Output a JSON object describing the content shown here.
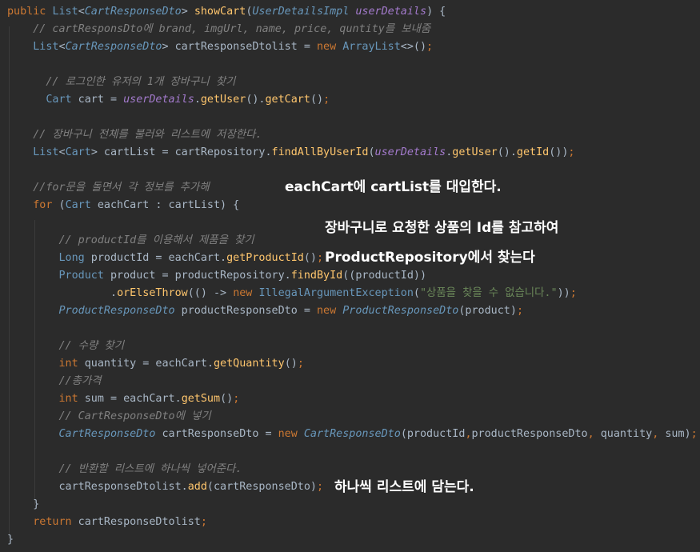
{
  "code_lines": [
    "public List<CartResponseDto> showCart(UserDetailsImpl userDetails) {",
    "    // cartResponsDto에 brand, imgUrl, name, price, quntity를 보내줌",
    "    List<CartResponseDto> cartResponseDtolist = new ArrayList<>();",
    "",
    "      // 로그인한 유저의 1개 장바구니 찾기",
    "      Cart cart = userDetails.getUser().getCart();",
    "",
    "    // 장바구니 전체를 불러와 리스트에 저장한다.",
    "    List<Cart> cartList = cartRepository.findAllByUserId(userDetails.getUser().getId());",
    "",
    "    //for문을 돌면서 각 정보를 추가해",
    "    for (Cart eachCart : cartList) {",
    "",
    "        // productId를 이용해서 제품을 찾기",
    "        Long productId = eachCart.getProductId();",
    "        Product product = productRepository.findById((productId))",
    "                .orElseThrow(() -> new IllegalArgumentException(\"상품을 찾을 수 없습니다.\"));",
    "        ProductResponseDto productResponseDto = new ProductResponseDto(product);",
    "",
    "        // 수량 찾기",
    "        int quantity = eachCart.getQuantity();",
    "        //총가격",
    "        int sum = eachCart.getSum();",
    "        // CartResponseDto에 넣기",
    "        CartResponseDto cartResponseDto = new CartResponseDto(productId,productResponseDto, quantity, sum);",
    "",
    "        // 반환할 리스트에 하나씩 넣어준다.",
    "        cartResponseDtolist.add(cartResponseDto);",
    "    }",
    "    return cartResponseDtolist;",
    "}"
  ],
  "annotations": {
    "each_cart": "eachCart에 cartList를 대입한다.",
    "find_product_1": "장바구니로 요청한 상품의 Id를 참고하여",
    "find_product_2": "ProductRepository에서 찾는다",
    "add_to_list": "하나씩 리스트에 담는다."
  },
  "colors": {
    "background": "#2b2b2b",
    "keyword": "#cc7832",
    "type": "#6897bb",
    "comment": "#808080",
    "method": "#ffc66d",
    "parameter": "#a37acc",
    "string": "#6a8759",
    "plain": "#a9b7c6",
    "annotation": "#ffffff"
  }
}
